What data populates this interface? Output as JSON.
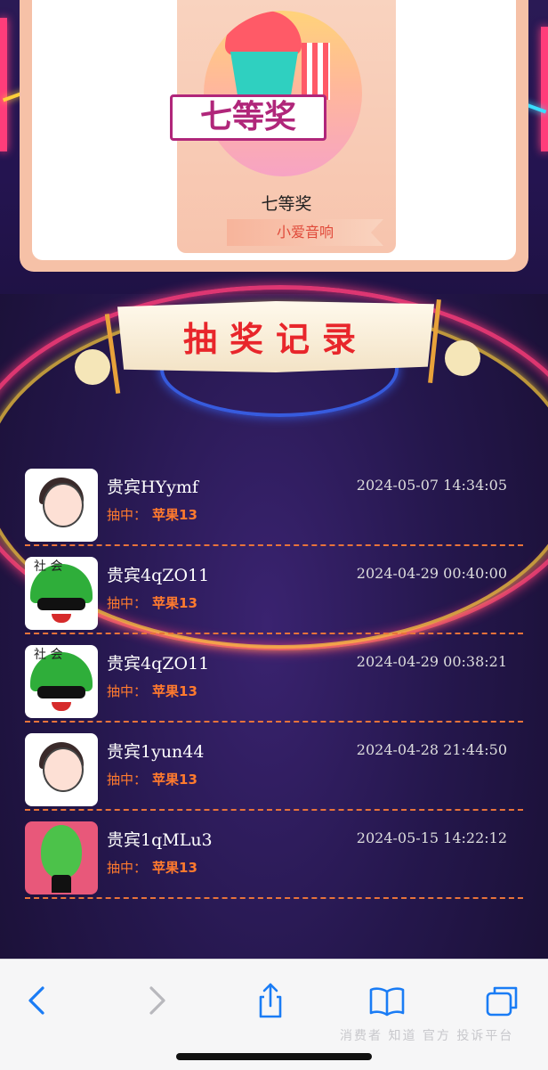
{
  "prize": {
    "banner_text": "七等奖",
    "name": "七等奖",
    "tag": "小爱音响"
  },
  "section_title": "抽奖记录",
  "records": [
    {
      "name": "贵宾HYymf",
      "time": "2024-05-07 14:34:05",
      "win_label": "抽中：",
      "win_item": "苹果13",
      "avatar": "girl-glasses-avatar"
    },
    {
      "name": "贵宾4qZO11",
      "time": "2024-04-29 00:40:00",
      "win_label": "抽中：",
      "win_item": "苹果13",
      "avatar": "watermelon-avatar",
      "avatar_text": "社 会"
    },
    {
      "name": "贵宾4qZO11",
      "time": "2024-04-29 00:38:21",
      "win_label": "抽中：",
      "win_item": "苹果13",
      "avatar": "watermelon-avatar",
      "avatar_text": "社 会"
    },
    {
      "name": "贵宾1yun44",
      "time": "2024-04-28 21:44:50",
      "win_label": "抽中：",
      "win_item": "苹果13",
      "avatar": "girl-glasses-avatar"
    },
    {
      "name": "贵宾1qMLu3",
      "time": "2024-05-15 14:22:12",
      "win_label": "抽中：",
      "win_item": "苹果13",
      "avatar": "pear-avatar"
    }
  ],
  "toolbar": {
    "icons": [
      "back-icon",
      "forward-icon",
      "share-icon",
      "bookmarks-icon",
      "tabs-icon"
    ]
  },
  "watermark": "消费者  知道 官方 投诉平台"
}
